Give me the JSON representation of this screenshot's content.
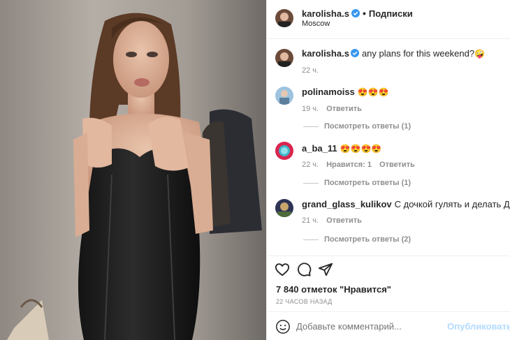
{
  "post": {
    "author": "karolisha.s",
    "follow_label": "Подписки",
    "separator": "•",
    "location": "Moscow",
    "caption": "any plans for this weekend?",
    "caption_emoji": "🤪",
    "caption_time": "22 ч."
  },
  "comments": [
    {
      "user": "polinamoiss",
      "text": "😍😍😍",
      "time": "19 ч.",
      "likes": "",
      "reply_label": "Ответить",
      "view_replies": "Посмотреть ответы (1)",
      "avatar_color": "#7fa7c9"
    },
    {
      "user": "a_ba_11",
      "text": "😍😍😍😍",
      "time": "22 ч.",
      "likes": "Нравится: 1",
      "reply_label": "Ответить",
      "view_replies": "Посмотреть ответы (1)",
      "avatar_color": "#d9254f"
    },
    {
      "user": "grand_glass_kulikov",
      "text": "С дочкой гулять и делать ДЗ",
      "emoji": "😁",
      "time": "21 ч.",
      "likes": "",
      "reply_label": "Ответить",
      "view_replies": "Посмотреть ответы (2)",
      "avatar_color": "#3a3f5c"
    }
  ],
  "actions": {
    "like_icon": "heart-icon",
    "comment_icon": "comment-icon",
    "share_icon": "share-icon",
    "likes_count": "7 840 отметок \"Нравится\"",
    "posted_time": "22 ЧАСОВ НАЗАД"
  },
  "add_comment": {
    "placeholder": "Добавьте комментарий...",
    "post_label": "Опубликовать"
  },
  "colors": {
    "verified": "#3897f0",
    "secondary_text": "#8e8e8e",
    "post_button_disabled": "#b3dbff"
  }
}
